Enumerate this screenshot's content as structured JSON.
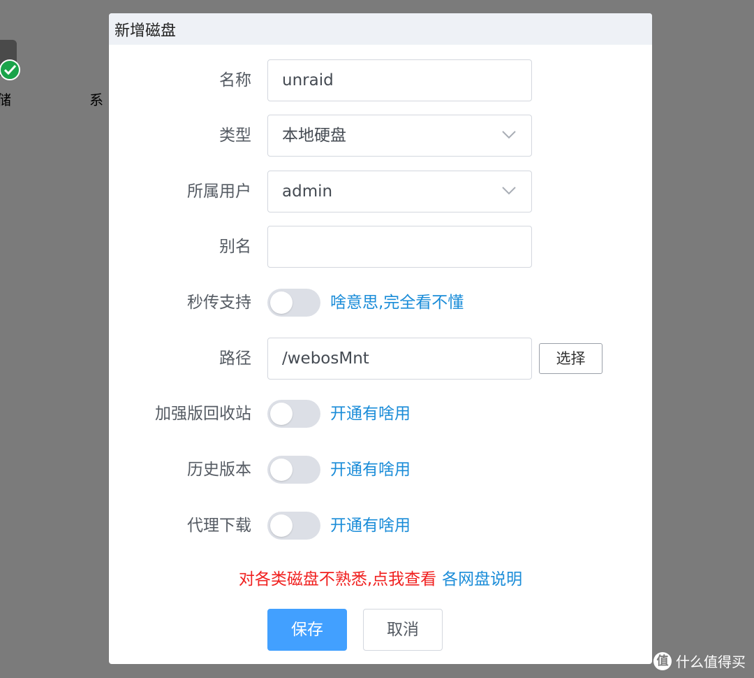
{
  "desktop": {
    "icons": [
      {
        "label": "存储"
      },
      {
        "label": "系"
      }
    ]
  },
  "dialog": {
    "title": "新增磁盘",
    "fields": {
      "name": {
        "label": "名称",
        "value": "unraid"
      },
      "type": {
        "label": "类型",
        "value": "本地硬盘"
      },
      "owner": {
        "label": "所属用户",
        "value": "admin"
      },
      "alias": {
        "label": "别名",
        "value": ""
      },
      "instant_upload": {
        "label": "秒传支持",
        "enabled": false,
        "help": "啥意思,完全看不懂"
      },
      "path": {
        "label": "路径",
        "value": "/webosMnt",
        "choose_button": "选择"
      },
      "recycle_bin": {
        "label": "加强版回收站",
        "enabled": false,
        "help": "开通有啥用"
      },
      "history": {
        "label": "历史版本",
        "enabled": false,
        "help": "开通有啥用"
      },
      "proxy_download": {
        "label": "代理下载",
        "enabled": false,
        "help": "开通有啥用"
      }
    },
    "notice": {
      "text": "对各类磁盘不熟悉,点我查看",
      "link": "各网盘说明"
    },
    "buttons": {
      "save": "保存",
      "cancel": "取消"
    }
  },
  "watermark": {
    "logo_char": "值",
    "text": "什么值得买"
  },
  "colors": {
    "primary": "#42a0ff",
    "link": "#1a8cd8",
    "warning": "#f0201f",
    "toggle_off": "#dcdfe6"
  }
}
